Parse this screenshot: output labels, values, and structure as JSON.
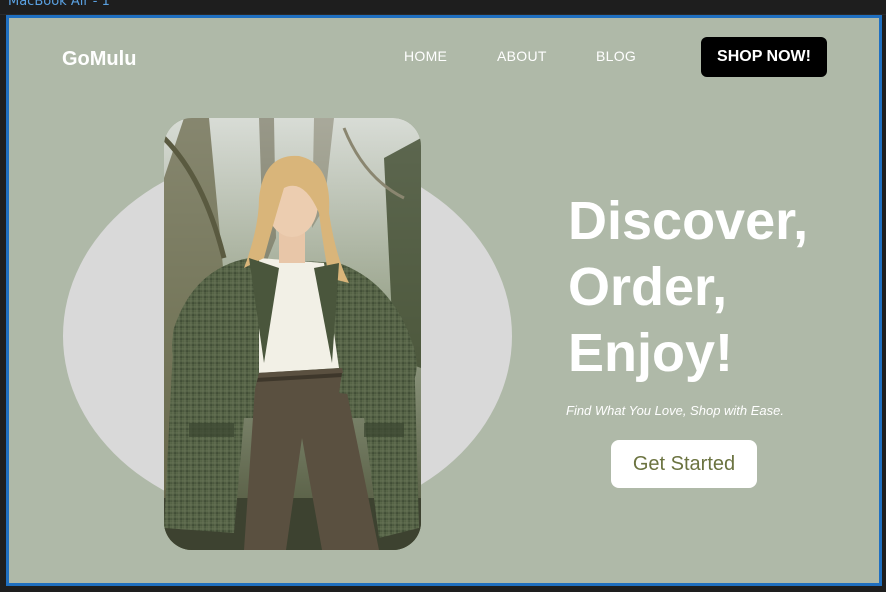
{
  "frame": {
    "label": "MacBook Air - 1"
  },
  "header": {
    "logo": "GoMulu",
    "nav": [
      {
        "label": "HOME"
      },
      {
        "label": "ABOUT"
      },
      {
        "label": "BLOG"
      }
    ],
    "shop_button": "SHOP NOW!"
  },
  "hero": {
    "headline": [
      "Discover,",
      "Order,",
      "Enjoy!"
    ],
    "tagline": "Find What You Love, Shop with Ease.",
    "cta_button": "Get Started",
    "image_subject": "woman in green plaid blazer, white blouse and brown trousers in forest"
  },
  "colors": {
    "page_background": "#afb9a8",
    "circle": "#d9d9d9",
    "shop_button_bg": "#000000",
    "cta_text": "#6b7340",
    "frame_border": "#1f6fc0"
  }
}
